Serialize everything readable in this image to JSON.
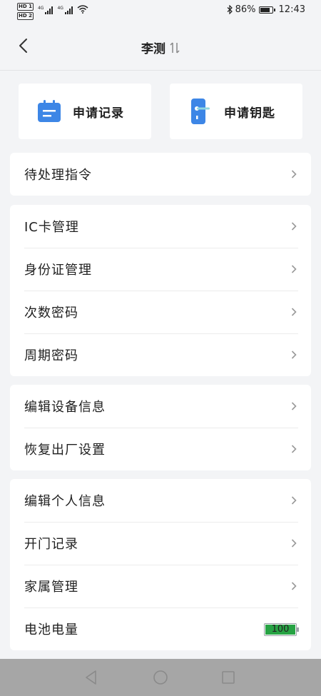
{
  "status_bar": {
    "hd_badges": [
      "HD 1",
      "HD 2"
    ],
    "network": [
      "4G",
      "4G"
    ],
    "battery_percent": "86%",
    "battery_level": 0.86,
    "time": "12:43"
  },
  "header": {
    "title": "李测"
  },
  "quick_actions": [
    {
      "label": "申请记录",
      "icon": "calendar-icon",
      "color": "#3d86e6"
    },
    {
      "label": "申请钥匙",
      "icon": "door-key-icon",
      "color": "#3d86e6"
    }
  ],
  "groups": [
    {
      "items": [
        {
          "label": "待处理指令"
        }
      ]
    },
    {
      "items": [
        {
          "label": "IC卡管理"
        },
        {
          "label": "身份证管理"
        },
        {
          "label": "次数密码"
        },
        {
          "label": "周期密码"
        }
      ]
    },
    {
      "items": [
        {
          "label": "编辑设备信息"
        },
        {
          "label": "恢复出厂设置"
        }
      ]
    },
    {
      "items": [
        {
          "label": "编辑个人信息"
        },
        {
          "label": "开门记录"
        },
        {
          "label": "家属管理"
        },
        {
          "label": "电池电量"
        }
      ]
    }
  ],
  "device_battery": {
    "value": "100",
    "level": 1.0,
    "color": "#27a344"
  },
  "nav_bar": {
    "buttons": [
      "back-icon",
      "home-icon",
      "recents-icon"
    ]
  }
}
